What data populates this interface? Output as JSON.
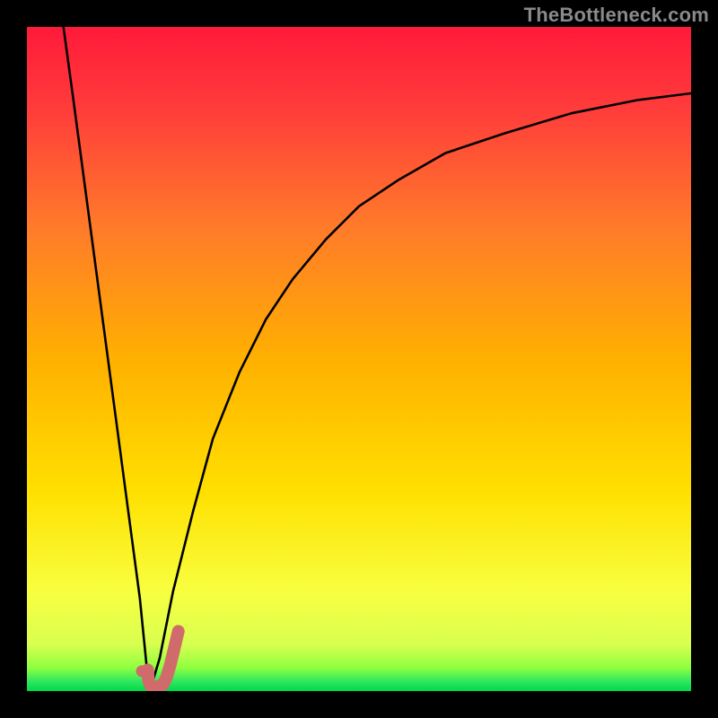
{
  "watermark": "TheBottleneck.com",
  "colors": {
    "bg_black": "#000000",
    "grad_top": "#ff1a3a",
    "grad_mid_upper": "#ff6a2a",
    "grad_mid": "#ffd400",
    "grad_lower": "#f6ff4a",
    "grad_bottom_band": "#7fff3a",
    "grad_bottom_line": "#00e050",
    "curve": "#000000",
    "marker_stroke": "#d16a6a",
    "marker_fill": "#d16a6a"
  },
  "chart_data": {
    "type": "line",
    "title": "",
    "xlabel": "",
    "ylabel": "",
    "xlim": [
      0,
      100
    ],
    "ylim": [
      0,
      100
    ],
    "notes": "Two black curves on a vertical red→yellow→green gradient. Left curve descends nearly vertically from the top-left to a minimum near x≈18; right curve rises sharply from that minimum and asymptotes toward y≈90 at the right edge. A coral J-shaped marker sits just right of the minimum; a small coral dot sits just left of it.",
    "series": [
      {
        "name": "left-branch",
        "x": [
          5.5,
          7,
          9,
          11,
          13,
          15,
          17,
          18,
          18.5
        ],
        "y": [
          100,
          89,
          74,
          59,
          44,
          29,
          14,
          4,
          0
        ]
      },
      {
        "name": "right-branch",
        "x": [
          18.5,
          20,
          22,
          25,
          28,
          32,
          36,
          40,
          45,
          50,
          56,
          63,
          72,
          82,
          92,
          100
        ],
        "y": [
          0,
          5,
          15,
          27,
          38,
          48,
          56,
          62,
          68,
          73,
          77,
          81,
          84,
          87,
          89,
          90
        ]
      }
    ],
    "markers": {
      "dot": {
        "x": 17.3,
        "y": 3.0
      },
      "j_hook": {
        "points_x": [
          18.2,
          18.3,
          18.6,
          19.5,
          20.5,
          21.0,
          21.6,
          22.2,
          22.8
        ],
        "points_y": [
          3.2,
          1.6,
          0.8,
          0.6,
          1.0,
          2.0,
          4.0,
          6.5,
          9.0
        ]
      }
    }
  }
}
